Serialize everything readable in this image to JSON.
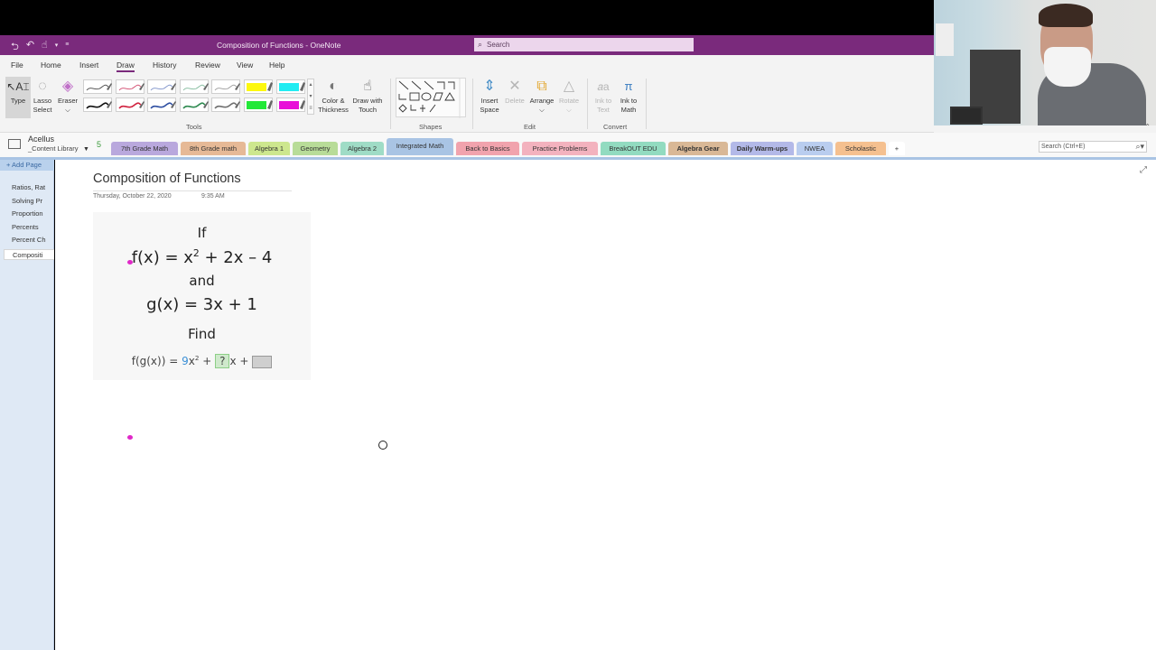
{
  "window": {
    "title": "Composition of Functions  -  OneNote",
    "search_placeholder": "Search",
    "quick_access": [
      "back-icon",
      "undo-icon",
      "touch-mode-icon",
      "dropdown-icon",
      "customize-icon"
    ]
  },
  "menu": {
    "tabs": [
      "File",
      "Home",
      "Insert",
      "Draw",
      "History",
      "Review",
      "View",
      "Help"
    ],
    "active": "Draw"
  },
  "ribbon": {
    "tools": {
      "type_label": "Type",
      "lasso_label": "Lasso Select",
      "eraser_label": "Eraser",
      "color_thickness_label": "Color & Thickness",
      "draw_touch_label": "Draw with Touch",
      "group_label": "Tools",
      "pens_row1": [
        "#444444",
        "#d0456a",
        "#7a8fc8",
        "#7fb99a",
        "#9a9a9a"
      ],
      "pens_row2": [
        "#111111",
        "#d0213e",
        "#2f4fa2",
        "#2e8a50",
        "#707070"
      ],
      "highlighters_row1": [
        "#fdf80e",
        "#22ecf2"
      ],
      "highlighters_row2": [
        "#22e838",
        "#e80fd8"
      ]
    },
    "shapes": {
      "group_label": "Shapes"
    },
    "edit": {
      "insert_space_label": "Insert Space",
      "delete_label": "Delete",
      "arrange_label": "Arrange",
      "rotate_label": "Rotate",
      "group_label": "Edit"
    },
    "convert": {
      "ink_to_text_label": "Ink to Text",
      "ink_to_math_label": "Ink to Math",
      "group_label": "Convert"
    }
  },
  "notebook": {
    "name": "Acellus",
    "subname": "_Content Library",
    "count": "5",
    "search_placeholder": "Search (Ctrl+E)",
    "sections": [
      {
        "label": "7th Grade Math",
        "color": "#b9a8dd"
      },
      {
        "label": "8th Grade math",
        "color": "#e6b996"
      },
      {
        "label": "Algebra 1",
        "color": "#cde78e"
      },
      {
        "label": "Geometry",
        "color": "#b8dc98"
      },
      {
        "label": "Algebra 2",
        "color": "#9fdcc6"
      },
      {
        "label": "Integrated Math",
        "color": "#a9c4e4"
      },
      {
        "label": "Back to Basics",
        "color": "#f1a3ad"
      },
      {
        "label": "Practice Problems",
        "color": "#f3b2be"
      },
      {
        "label": "BreakOUT EDU",
        "color": "#92dbc0"
      },
      {
        "label": "Algebra Gear",
        "color": "#d9b896"
      },
      {
        "label": "Daily Warm-ups",
        "color": "#b3b9e8"
      },
      {
        "label": "NWEA",
        "color": "#b9cdef"
      },
      {
        "label": "Scholastic",
        "color": "#f5c08f"
      }
    ],
    "active_section": "Integrated Math",
    "add_section_label": "+"
  },
  "pages": {
    "add_page_label": "+ Add Page",
    "items": [
      "Ratios, Rat",
      "Solving Pr",
      "Proportion",
      "Percents",
      "Percent Ch",
      "Compositi"
    ],
    "active": "Compositi"
  },
  "page": {
    "title": "Composition of Functions",
    "date": "Thursday, October 22, 2020",
    "time": "9:35 AM",
    "problem": {
      "line1": "If",
      "line2_pre": "f(x) = x",
      "line2_exp": "2",
      "line2_post": " + 2x – 4",
      "line3": "and",
      "line4": "g(x) = 3x + 1",
      "line5": "Find",
      "answer_pre": "f(g(x)) = ",
      "answer_coef": "9",
      "answer_x2": "x",
      "answer_exp": "2",
      "answer_plus1": " + ",
      "answer_box1": "?",
      "answer_x": "x + ",
      "answer_box2": ""
    }
  }
}
